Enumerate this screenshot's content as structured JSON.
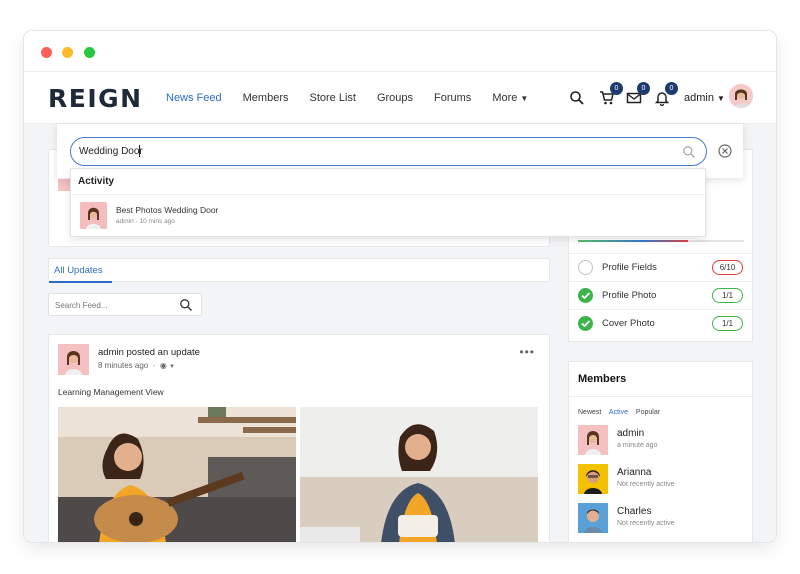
{
  "window": {
    "traffic_lights": [
      "close",
      "minimize",
      "zoom"
    ]
  },
  "header": {
    "logo": "REIGN",
    "nav": [
      {
        "label": "News Feed",
        "active": true
      },
      {
        "label": "Members"
      },
      {
        "label": "Store List"
      },
      {
        "label": "Groups"
      },
      {
        "label": "Forums"
      },
      {
        "label": "More"
      }
    ],
    "icons": {
      "search": "search-icon",
      "cart": "cart-icon",
      "mail": "mail-icon",
      "bell": "bell-icon"
    },
    "badges": {
      "cart": "0",
      "mail": "0",
      "bell": "0"
    },
    "user": {
      "name": "admin"
    },
    "accent": "#2f6bc5"
  },
  "search": {
    "query": "Wedding Door",
    "results_heading": "Activity",
    "results": [
      {
        "title": "Best Photos Wedding Door",
        "author": "admin",
        "time": "10 mins ago"
      }
    ]
  },
  "feed": {
    "tabs": [
      "All Updates"
    ],
    "search_placeholder": "Search Feed...",
    "post": {
      "author_line": "admin posted an update",
      "time": "8 minutes ago",
      "text": "Learning Management View"
    }
  },
  "profile_completion": {
    "progress_fraction": 0.66,
    "rows": [
      {
        "label": "Profile Fields",
        "value": "6/10",
        "done": false
      },
      {
        "label": "Profile Photo",
        "value": "1/1",
        "done": true
      },
      {
        "label": "Cover Photo",
        "value": "1/1",
        "done": true
      }
    ]
  },
  "members": {
    "title": "Members",
    "filters": [
      "Newest",
      "Active",
      "Popular"
    ],
    "active_filter": "Active",
    "list": [
      {
        "name": "admin",
        "status": "a minute ago"
      },
      {
        "name": "Arianna",
        "status": "Not recently active"
      },
      {
        "name": "Charles",
        "status": "Not recently active"
      }
    ]
  }
}
